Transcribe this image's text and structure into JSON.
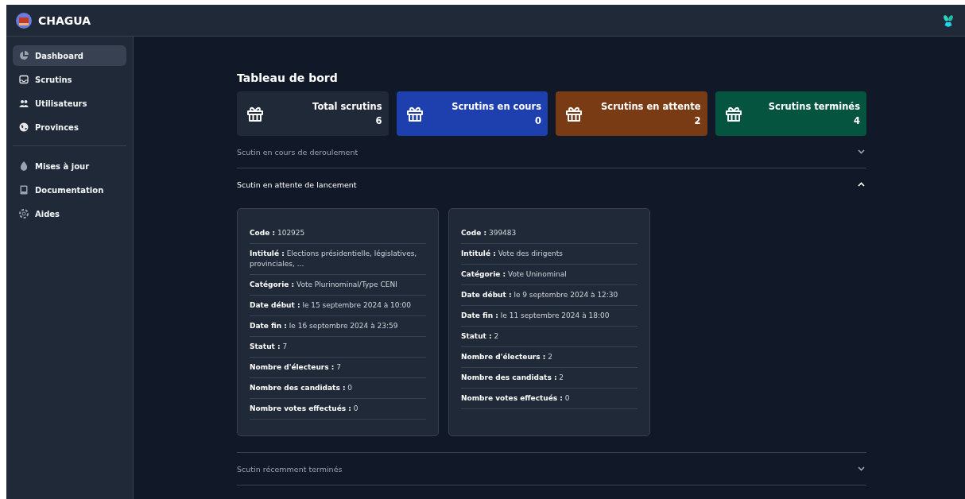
{
  "app": {
    "name": "CHAGUA"
  },
  "sidebar": {
    "items": [
      {
        "label": "Dashboard",
        "selected": true
      },
      {
        "label": "Scrutins",
        "selected": false
      },
      {
        "label": "Utilisateurs",
        "selected": false
      },
      {
        "label": "Provinces",
        "selected": false
      }
    ],
    "secondary_items": [
      {
        "label": "Mises à jour"
      },
      {
        "label": "Documentation"
      },
      {
        "label": "Aides"
      }
    ]
  },
  "page_title": "Tableau de bord",
  "stats": [
    {
      "label": "Total scrutins",
      "value": "6",
      "color": "#1f2937"
    },
    {
      "label": "Scrutins en cours",
      "value": "0",
      "color": "#1e40af"
    },
    {
      "label": "Scrutins en attente",
      "value": "2",
      "color": "#783b13"
    },
    {
      "label": "Scrutins terminés",
      "value": "4",
      "color": "#04543f"
    }
  ],
  "sections": [
    {
      "title": "Scutin en cours de deroulement",
      "expanded": false
    },
    {
      "title": "Scutin en attente de lancement",
      "expanded": true,
      "cards": [
        {
          "fields": [
            {
              "label": "Code :",
              "value": "102925"
            },
            {
              "label": "Intitulé :",
              "value": "Elections présidentielle, législatives, provinciales, ..."
            },
            {
              "label": "Catégorie :",
              "value": "Vote Plurinominal/Type CENI"
            },
            {
              "label": "Date début :",
              "value": "le 15 septembre 2024 à 10:00"
            },
            {
              "label": "Date fin :",
              "value": "le 16 septembre 2024 à 23:59"
            },
            {
              "label": "Statut :",
              "value": "7"
            },
            {
              "label": "Nombre d'électeurs :",
              "value": "7"
            },
            {
              "label": "Nombre des candidats :",
              "value": "0"
            },
            {
              "label": "Nombre votes effectués :",
              "value": "0"
            }
          ]
        },
        {
          "fields": [
            {
              "label": "Code :",
              "value": "399483"
            },
            {
              "label": "Intitulé :",
              "value": "Vote des dirigents"
            },
            {
              "label": "Catégorie :",
              "value": "Vote Uninominal"
            },
            {
              "label": "Date début :",
              "value": "le 9 septembre 2024 à 12:30"
            },
            {
              "label": "Date fin :",
              "value": "le 11 septembre 2024 à 18:00"
            },
            {
              "label": "Statut :",
              "value": "2"
            },
            {
              "label": "Nombre d'électeurs :",
              "value": "2"
            },
            {
              "label": "Nombre des candidats :",
              "value": "2"
            },
            {
              "label": "Nombre votes effectués :",
              "value": "0"
            }
          ]
        }
      ]
    },
    {
      "title": "Scutin récemment terminés",
      "expanded": false
    }
  ]
}
